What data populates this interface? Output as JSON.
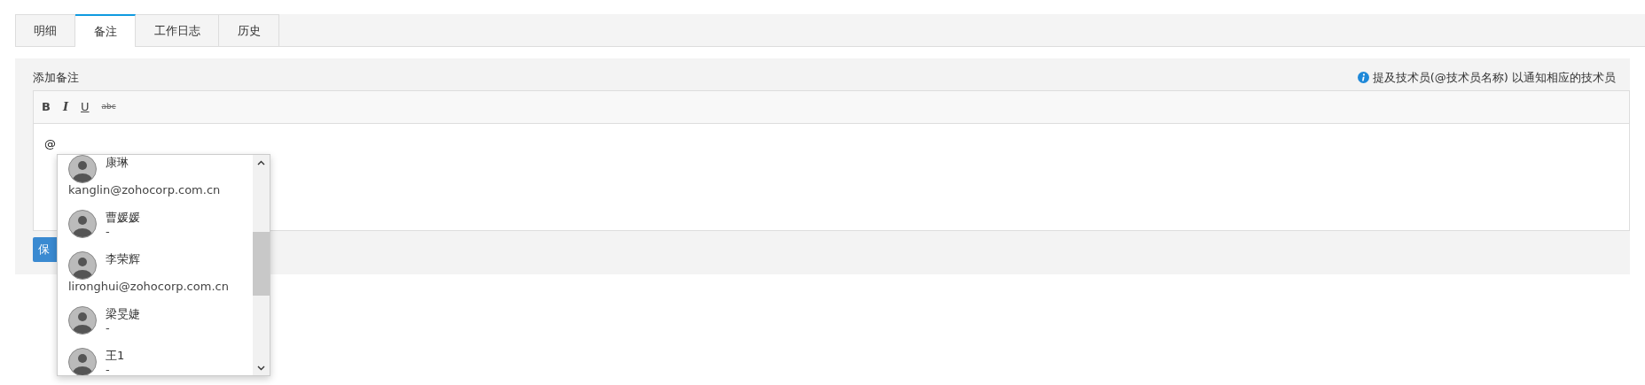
{
  "tabs": [
    {
      "label": "明细",
      "selected": false
    },
    {
      "label": "备注",
      "selected": true
    },
    {
      "label": "工作日志",
      "selected": false
    },
    {
      "label": "历史",
      "selected": false
    }
  ],
  "notes": {
    "label": "添加备注",
    "hint": "提及技术员(@技术员名称) 以通知相应的技术员",
    "toolbar": [
      {
        "kind": "bold",
        "label": "B"
      },
      {
        "kind": "italic",
        "label": "I"
      },
      {
        "kind": "underline",
        "label": "U"
      },
      {
        "kind": "strike",
        "label": "abc"
      }
    ],
    "editor_text": "@",
    "save_button": "保",
    "mention_list": [
      {
        "name": "康琳",
        "detail": "kanglin@zohocorp.com.cn"
      },
      {
        "name": "曹媛媛",
        "detail": "-"
      },
      {
        "name": "李荣辉",
        "detail": "lironghui@zohocorp.com.cn"
      },
      {
        "name": "梁旻婕",
        "detail": "-"
      },
      {
        "name": "王1",
        "detail": "-"
      }
    ]
  }
}
